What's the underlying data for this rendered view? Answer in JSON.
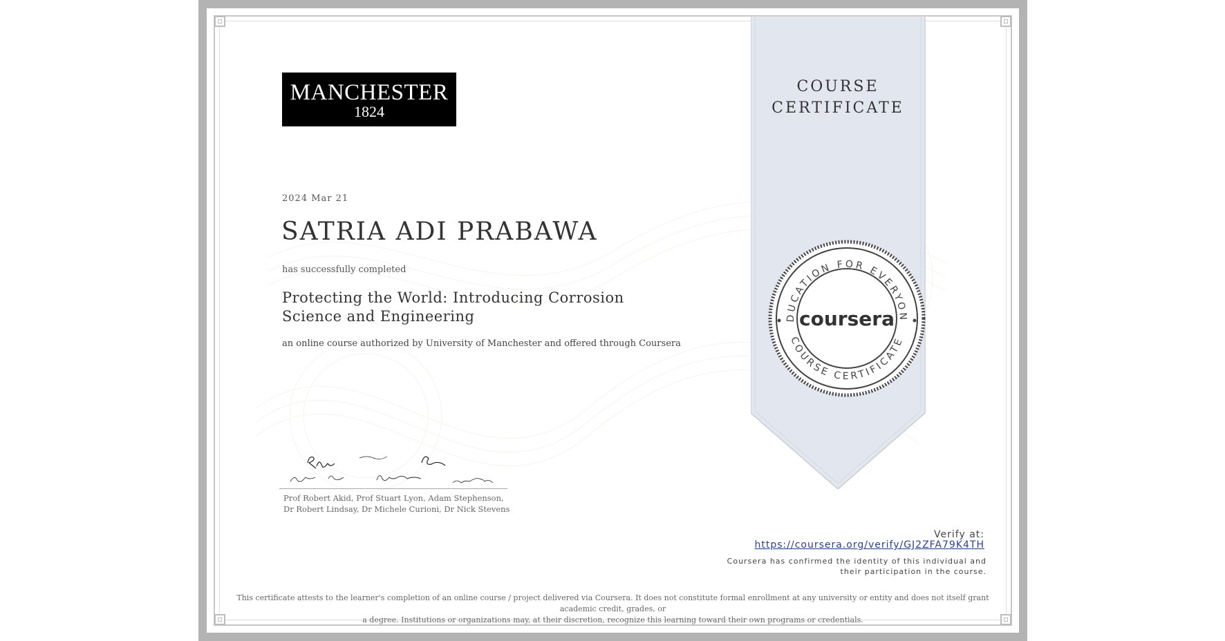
{
  "logo": {
    "text_name": "MANCHESTER",
    "text_year": "1824"
  },
  "date": "2024 Mar 21",
  "recipient_name": "SATRIA ADI PRABAWA",
  "completed_text": "has successfully completed",
  "course_title": "Protecting the World: Introducing Corrosion Science and Engineering",
  "authorized_text": "an online course authorized by University of Manchester and offered through Coursera",
  "signatories": {
    "line1": "Prof Robert Akid, Prof Stuart Lyon, Adam Stephenson,",
    "line2": "Dr Robert Lindsay, Dr Michele Curioni, Dr Nick Stevens"
  },
  "ribbon": {
    "line1": "COURSE",
    "line2": "CERTIFICATE"
  },
  "seal": {
    "brand": "coursera",
    "top_arc": "EDUCATION FOR EVERYONE",
    "bottom_arc": "COURSE CERTIFICATE"
  },
  "verify": {
    "label": "Verify at:",
    "url": "https://coursera.org/verify/GJ2ZFA79K4TH",
    "note": "Coursera has confirmed the identity of this individual and their participation in the course."
  },
  "disclaimer": {
    "line1": "This certificate attests to the learner's completion of an online course / project delivered via Coursera. It does not constitute formal enrollment at any university or entity and does not itself grant academic credit, grades, or",
    "line2": "a degree. Institutions or organizations may, at their discretion, recognize this learning toward their own programs or credentials."
  },
  "colors": {
    "ribbon": "#e2e6ee",
    "link": "#2a3fa0",
    "frame": "#b3b3b3"
  }
}
